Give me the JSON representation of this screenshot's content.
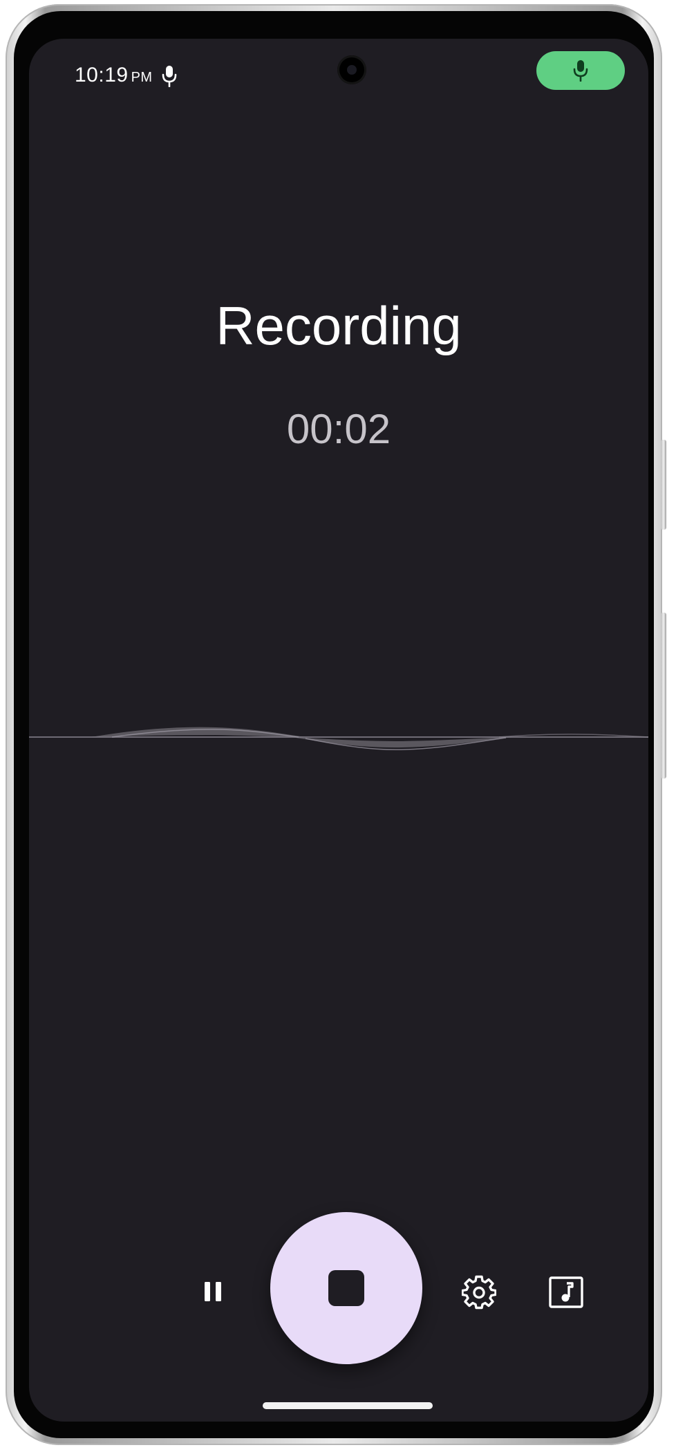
{
  "status_bar": {
    "time": "10:19",
    "ampm": "PM",
    "mic_icon": "microphone-icon",
    "recording_chip_icon": "microphone-icon",
    "recording_chip_color": "#5fcf83"
  },
  "recorder": {
    "title": "Recording",
    "elapsed": "00:02"
  },
  "controls": {
    "pause_icon": "pause-icon",
    "stop_icon": "stop-icon",
    "settings_icon": "gear-icon",
    "media_icon": "music-note-icon",
    "stop_button_color": "#e8dbf8"
  },
  "colors": {
    "screen_background": "#1f1d23",
    "title_text": "#ffffff",
    "timer_text": "#c6c3c9"
  }
}
